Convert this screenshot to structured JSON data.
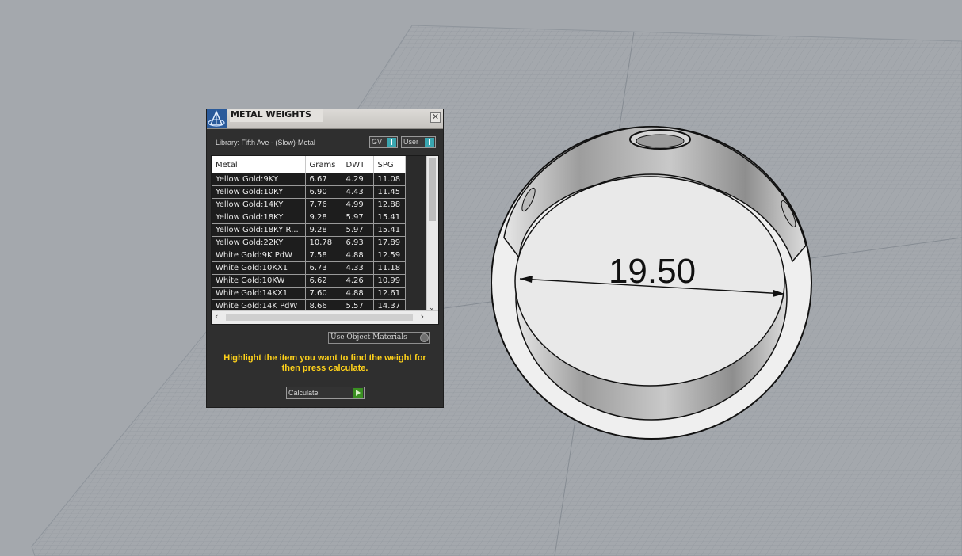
{
  "panel": {
    "title": "METAL WEIGHTS",
    "close_glyph": "✕",
    "library_label": "Library: Fifth Ave - (Slow)-Metal",
    "toggles": [
      {
        "label": "GV",
        "state": "on"
      },
      {
        "label": "User",
        "state": "on"
      }
    ],
    "table": {
      "headers": [
        "Metal",
        "Grams",
        "DWT",
        "SPG"
      ],
      "rows": [
        [
          "Yellow Gold:9KY",
          "6.67",
          "4.29",
          "11.08"
        ],
        [
          "Yellow Gold:10KY",
          "6.90",
          "4.43",
          "11.45"
        ],
        [
          "Yellow Gold:14KY",
          "7.76",
          "4.99",
          "12.88"
        ],
        [
          "Yellow Gold:18KY",
          "9.28",
          "5.97",
          "15.41"
        ],
        [
          "Yellow Gold:18KY R...",
          "9.28",
          "5.97",
          "15.41"
        ],
        [
          "Yellow Gold:22KY",
          "10.78",
          "6.93",
          "17.89"
        ],
        [
          "White Gold:9K PdW",
          "7.58",
          "4.88",
          "12.59"
        ],
        [
          "White Gold:10KX1",
          "6.73",
          "4.33",
          "11.18"
        ],
        [
          "White Gold:10KW",
          "6.62",
          "4.26",
          "10.99"
        ],
        [
          "White Gold:14KX1",
          "7.60",
          "4.88",
          "12.61"
        ],
        [
          "White Gold:14K PdW",
          "8.66",
          "5.57",
          "14.37"
        ]
      ]
    },
    "use_object_materials": "Use Object Materials",
    "hint": "Highlight the item you want to find the weight for then press calculate.",
    "calculate_label": "Calculate"
  },
  "viewport": {
    "dimension_value": "19.50",
    "grid_color": "#8f959c",
    "background_color": "#a4a8ad",
    "ring_color": "#e8e8e8"
  },
  "icons": {
    "logo": "rhino-app-icon",
    "close": "close-icon",
    "scroll_up": "chevron-up-icon",
    "scroll_down": "chevron-down-icon",
    "scroll_left": "chevron-left-icon",
    "scroll_right": "chevron-right-icon",
    "play": "play-icon"
  }
}
